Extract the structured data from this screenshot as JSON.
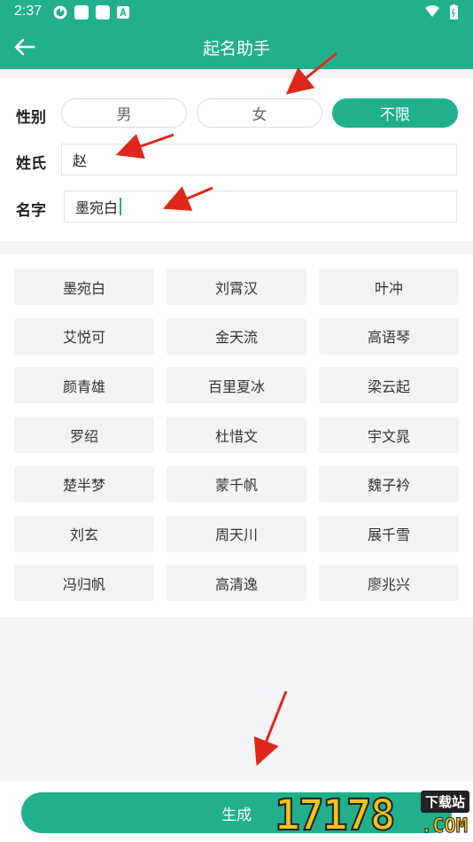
{
  "status_bar": {
    "time": "2:37"
  },
  "app_bar": {
    "title": "起名助手"
  },
  "form": {
    "gender_label": "性别",
    "gender_options": [
      "男",
      "女",
      "不限"
    ],
    "gender_selected": "不限",
    "surname_label": "姓氏",
    "surname_value": "赵",
    "name_label": "名字",
    "name_value": "墨宛白"
  },
  "names": [
    [
      "墨宛白",
      "刘霄汉",
      "叶冲"
    ],
    [
      "艾悦可",
      "金天流",
      "高语琴"
    ],
    [
      "颜青雄",
      "百里夏冰",
      "梁云起"
    ],
    [
      "罗绍",
      "杜惜文",
      "宇文晁"
    ],
    [
      "楚半梦",
      "蒙千帆",
      "魏子衿"
    ],
    [
      "刘玄",
      "周天川",
      "展千雪"
    ],
    [
      "冯归帆",
      "高清逸",
      "廖兆兴"
    ]
  ],
  "actions": {
    "generate_label": "生成"
  },
  "watermark": {
    "number": "17178",
    "tag": "下载站",
    "suffix": ".COM"
  },
  "colors": {
    "accent": "#21b08b",
    "annotation_arrow": "#e0261b"
  }
}
